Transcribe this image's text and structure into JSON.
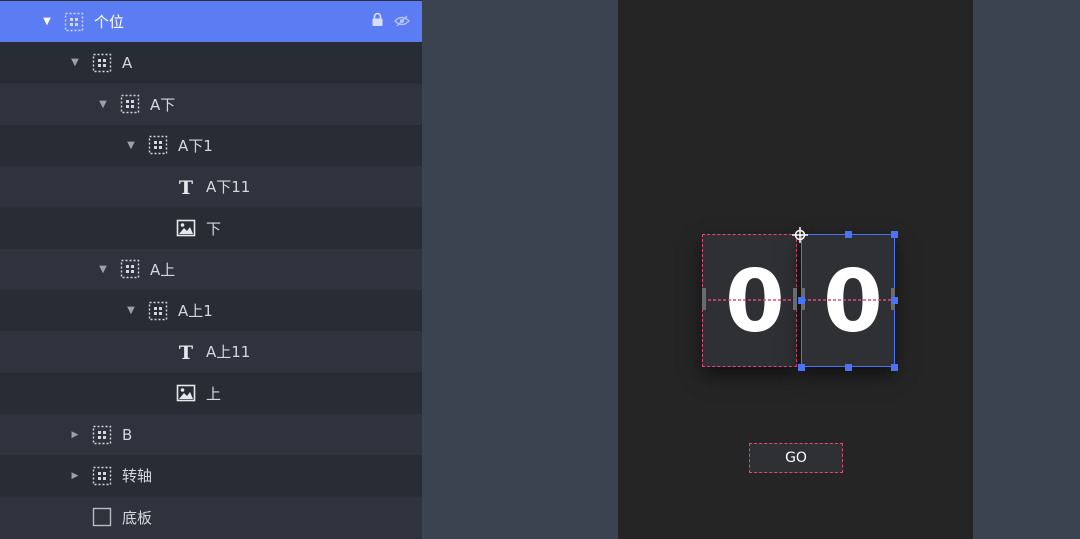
{
  "layers": [
    {
      "label": "个位",
      "depth": 0,
      "arrow": "down",
      "icon": "group",
      "selected": true
    },
    {
      "label": "A",
      "depth": 1,
      "arrow": "down",
      "icon": "group"
    },
    {
      "label": "A下",
      "depth": 2,
      "arrow": "down",
      "icon": "group"
    },
    {
      "label": "A下1",
      "depth": 3,
      "arrow": "down",
      "icon": "group"
    },
    {
      "label": "A下11",
      "depth": 4,
      "arrow": "none",
      "icon": "text"
    },
    {
      "label": "下",
      "depth": 4,
      "arrow": "none",
      "icon": "image"
    },
    {
      "label": "A上",
      "depth": 2,
      "arrow": "down",
      "icon": "group"
    },
    {
      "label": "A上1",
      "depth": 3,
      "arrow": "down",
      "icon": "group"
    },
    {
      "label": "A上11",
      "depth": 4,
      "arrow": "none",
      "icon": "text"
    },
    {
      "label": "上",
      "depth": 4,
      "arrow": "none",
      "icon": "image"
    },
    {
      "label": "B",
      "depth": 1,
      "arrow": "right",
      "icon": "group"
    },
    {
      "label": "转轴",
      "depth": 1,
      "arrow": "right",
      "icon": "group"
    },
    {
      "label": "底板",
      "depth": 1,
      "arrow": "none",
      "icon": "rect"
    }
  ],
  "selected_row_tools": {
    "lock_icon": "lock-icon",
    "visibility_icon": "eye-hidden-icon"
  },
  "canvas": {
    "digit_left": "0",
    "digit_right": "0",
    "go_label": "GO"
  },
  "colors": {
    "selection": "#5b7cf2",
    "handle": "#4a73f5",
    "guide": "#e0487a",
    "artboard": "#252526",
    "panel": "#2b2f38"
  }
}
